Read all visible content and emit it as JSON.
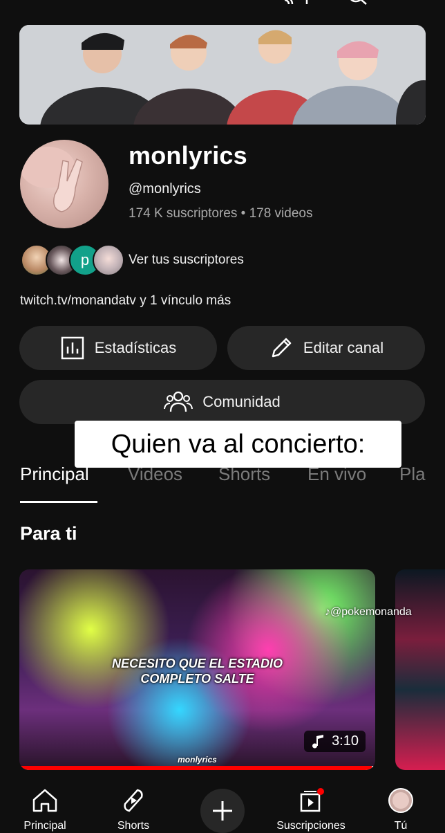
{
  "channel": {
    "name": "monlyrics",
    "handle": "@monlyrics",
    "stats": "174 K suscriptores • 178 videos",
    "see_subscribers": "Ver tus suscriptores",
    "links": "twitch.tv/monandatv y 1 vínculo más",
    "sub_avatar_letter": "p"
  },
  "buttons": {
    "analytics": "Estadísticas",
    "edit": "Editar canal",
    "community": "Comunidad"
  },
  "overlay_caption": "Quien va al concierto:",
  "tabs": [
    {
      "label": "Principal",
      "active": true
    },
    {
      "label": "Videos",
      "active": false
    },
    {
      "label": "Shorts",
      "active": false
    },
    {
      "label": "En vivo",
      "active": false
    },
    {
      "label": "Pla",
      "active": false
    }
  ],
  "section": {
    "title": "Para ti"
  },
  "video": {
    "thumb_text_line1": "NECESITO QUE EL ESTADIO",
    "thumb_text_line2": "COMPLETO SALTE",
    "thumb_watermark": "monlyrics",
    "duration": "3:10",
    "progress": 0.99
  },
  "tiktok_watermark": "@pokemonanda",
  "bottom_nav": {
    "home": "Principal",
    "shorts": "Shorts",
    "subscriptions": "Suscripciones",
    "you": "Tú"
  },
  "colors": {
    "accent": "#ff0000",
    "surface": "#272727",
    "background": "#0f0f0f"
  }
}
